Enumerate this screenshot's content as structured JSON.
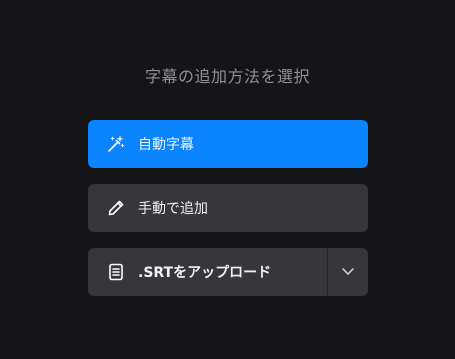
{
  "dialog": {
    "title": "字幕の追加方法を選択"
  },
  "options": {
    "auto_captions": {
      "label": "自動字幕",
      "icon": "magic-wand-icon",
      "color": "#0b84ff"
    },
    "manual_add": {
      "label": "手動で追加",
      "icon": "pencil-icon"
    },
    "upload_srt": {
      "label": ".SRTをアップロード",
      "icon": "document-icon",
      "dropdown_icon": "chevron-down-icon"
    }
  },
  "colors": {
    "background": "#151518",
    "primary": "#0b84ff",
    "secondary": "#36363b",
    "title_text": "#8f9096",
    "button_text": "#f2f2f4"
  }
}
